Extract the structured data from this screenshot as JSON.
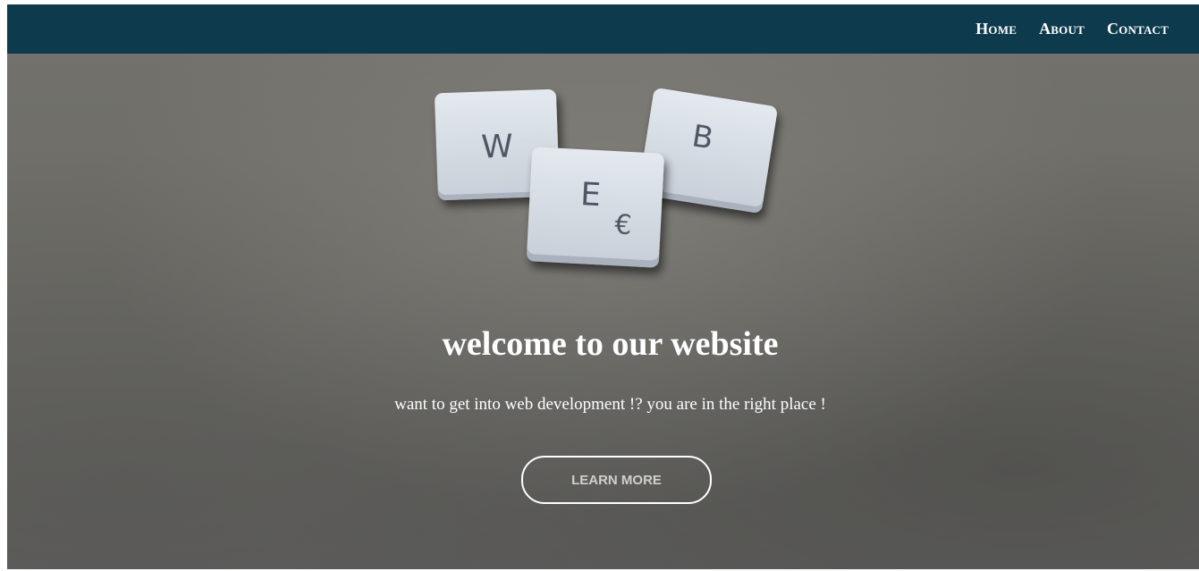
{
  "nav": {
    "items": [
      {
        "label": "Home"
      },
      {
        "label": "About"
      },
      {
        "label": "Contact"
      }
    ]
  },
  "hero": {
    "title": "welcome to our website",
    "subtitle": "want to get into web development !? you are in the right place !",
    "button_label": "LEARN MORE",
    "tiles": [
      {
        "letter": "W"
      },
      {
        "letter": "E"
      },
      {
        "letter": "B"
      }
    ],
    "tile_currency": "€"
  },
  "colors": {
    "navbar": "#0e3a4e",
    "text": "#ffffff",
    "button_text": "#cfcfcc"
  }
}
